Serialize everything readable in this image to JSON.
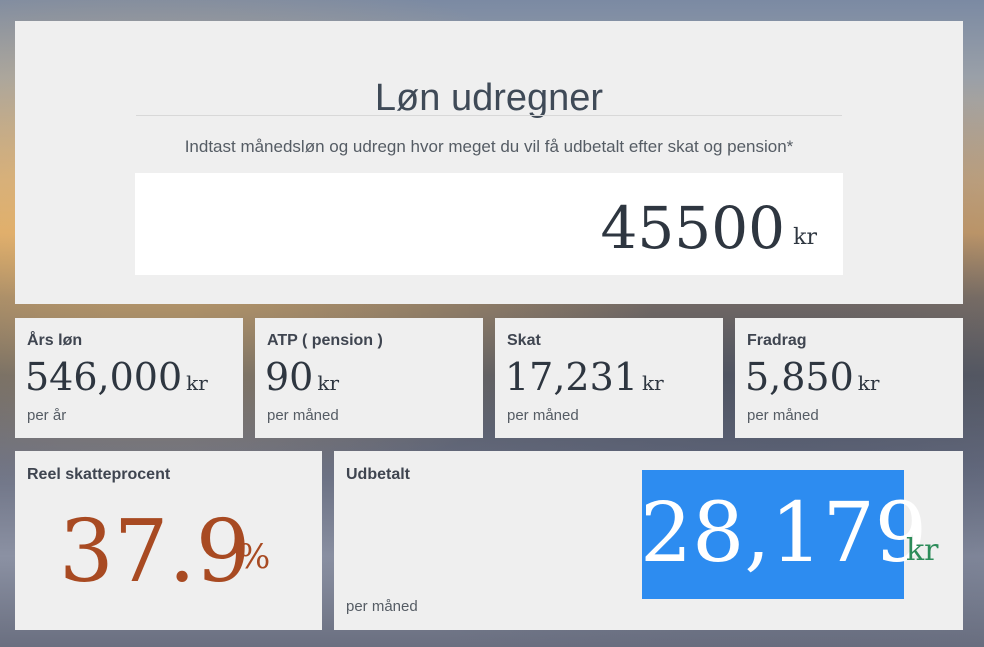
{
  "header": {
    "title": "Løn udregner",
    "subtitle": "Indtast månedsløn og udregn hvor meget du vil få udbetalt efter skat og pension*"
  },
  "salary_input": {
    "value": "45500",
    "unit": "kr"
  },
  "cards": [
    {
      "label": "Års løn",
      "value": "546,000",
      "unit": "kr",
      "sub": "per år"
    },
    {
      "label": "ATP ( pension )",
      "value": "90",
      "unit": "kr",
      "sub": "per måned"
    },
    {
      "label": "Skat",
      "value": "17,231",
      "unit": "kr",
      "sub": "per måned"
    },
    {
      "label": "Fradrag",
      "value": "5,850",
      "unit": "kr",
      "sub": "per måned"
    }
  ],
  "tax_rate": {
    "label": "Reel skatteprocent",
    "value": "37.9",
    "unit": "%",
    "color": "#a84a22"
  },
  "payout": {
    "label": "Udbetalt",
    "value": "28,179",
    "unit": "kr",
    "sub": "per måned",
    "highlight_color": "#2d8cf0"
  }
}
